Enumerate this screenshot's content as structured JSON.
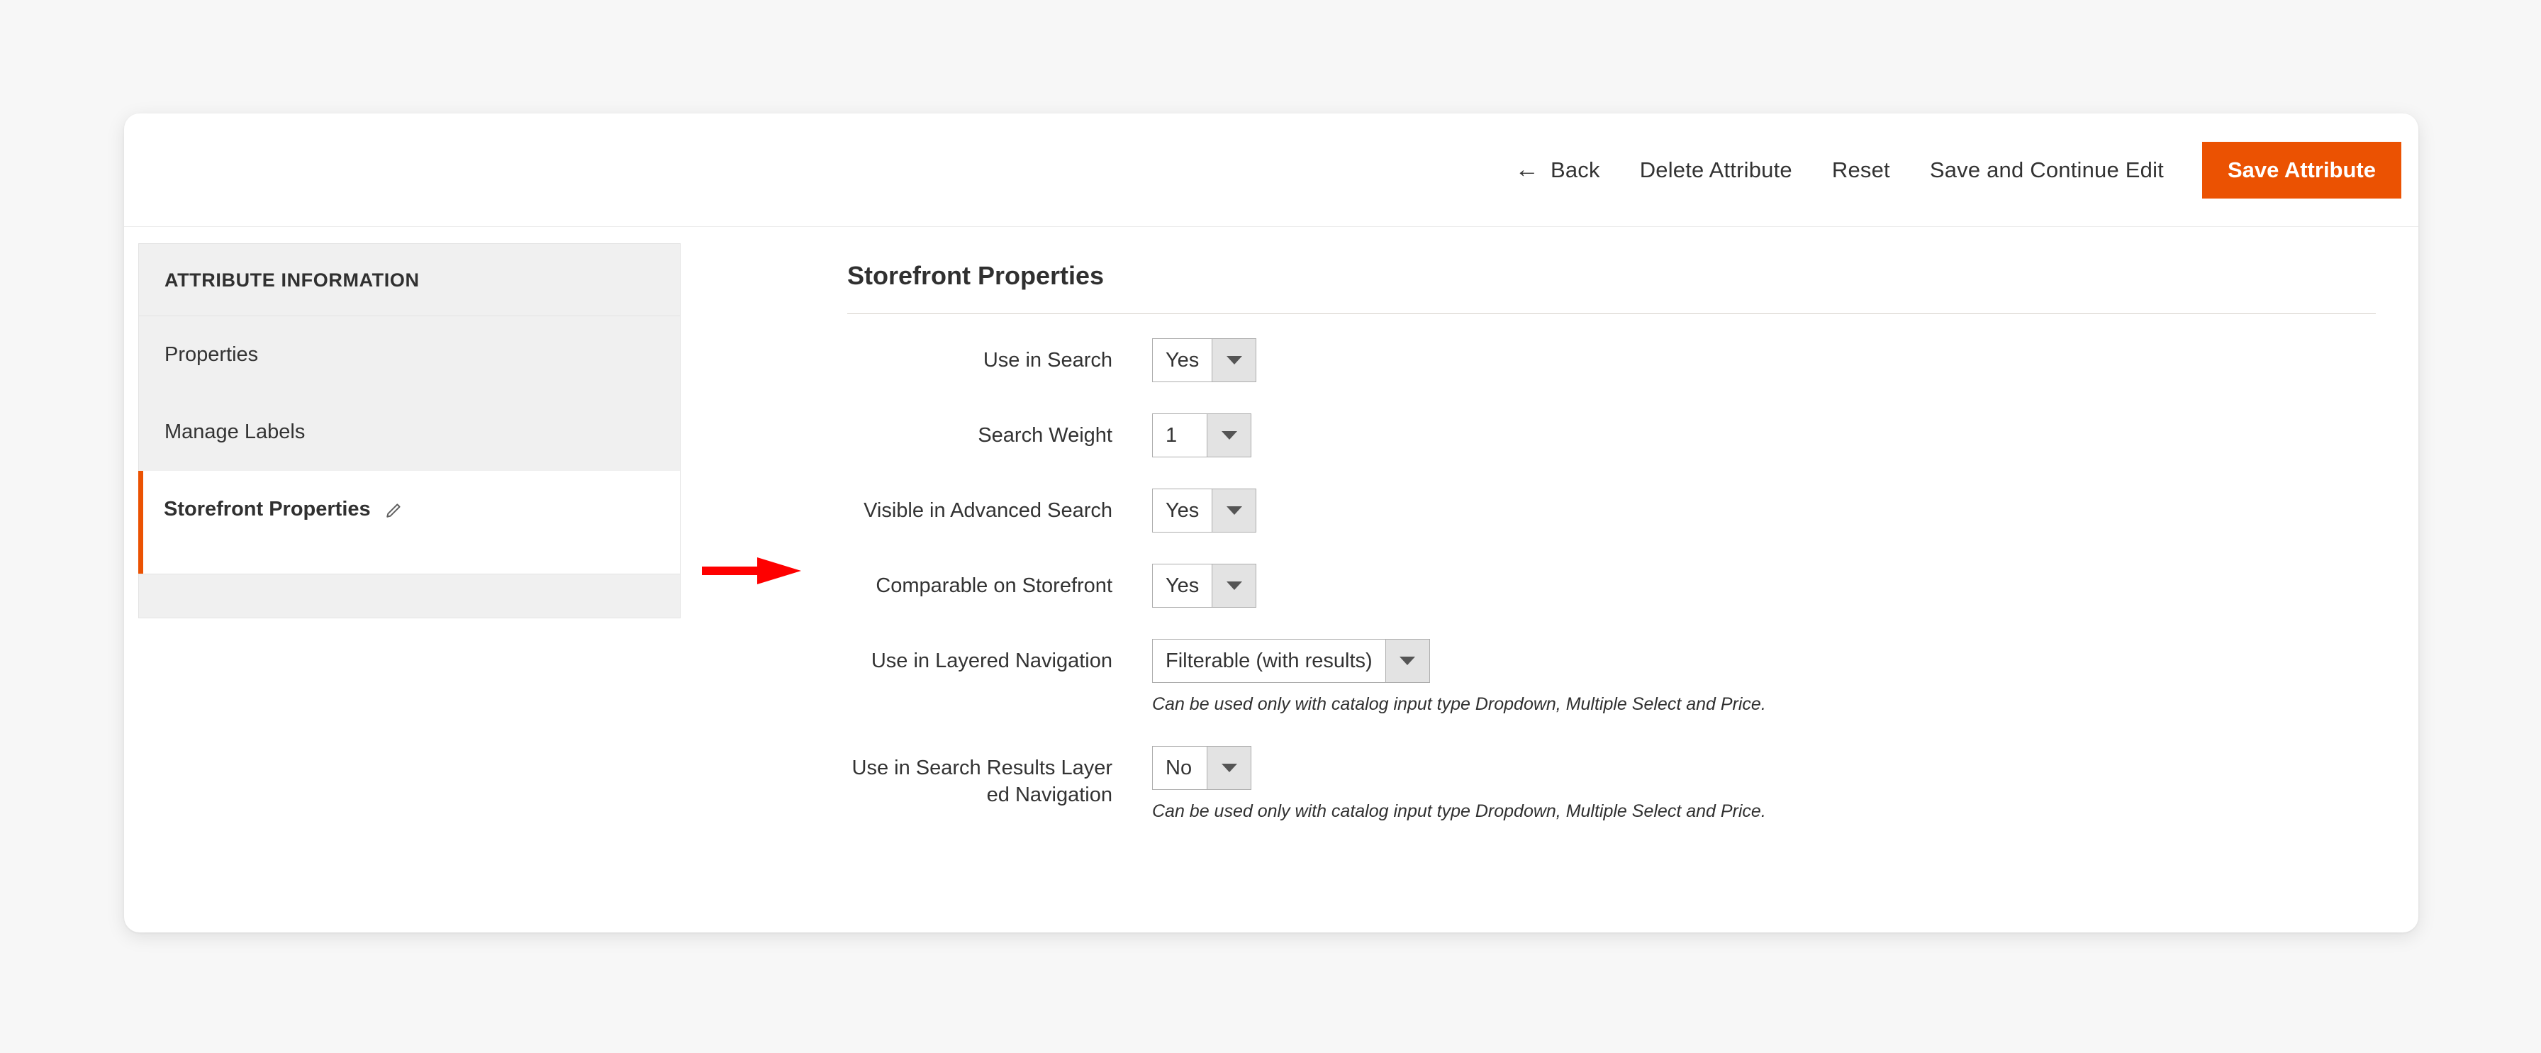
{
  "toolbar": {
    "back_label": "Back",
    "back_icon": "arrow-left-icon",
    "delete_label": "Delete Attribute",
    "reset_label": "Reset",
    "save_continue_label": "Save and Continue Edit",
    "save_label": "Save Attribute",
    "primary_color": "#eb5202"
  },
  "sidebar": {
    "header": "ATTRIBUTE INFORMATION",
    "items": [
      {
        "label": "Properties",
        "active": false
      },
      {
        "label": "Manage Labels",
        "active": false
      },
      {
        "label": "Storefront Properties",
        "active": true,
        "icon": "pencil-icon"
      }
    ]
  },
  "main": {
    "section_title": "Storefront Properties",
    "fields": [
      {
        "label": "Use in Search",
        "value": "Yes",
        "hint": ""
      },
      {
        "label": "Search Weight",
        "value": "1",
        "hint": ""
      },
      {
        "label": "Visible in Advanced Search",
        "value": "Yes",
        "hint": ""
      },
      {
        "label": "Comparable on Storefront",
        "value": "Yes",
        "hint": ""
      },
      {
        "label": "Use in Layered Navigation",
        "value": "Filterable (with results)",
        "hint": "Can be used only with catalog input type Dropdown, Multiple Select and Price."
      },
      {
        "label": "Use in Search Results Layered Navigation",
        "value": "No",
        "hint": "Can be used only with catalog input type Dropdown, Multiple Select and Price."
      }
    ]
  },
  "annotation": {
    "type": "arrow",
    "color": "#fe0000",
    "points_to": "Visible in Advanced Search"
  }
}
